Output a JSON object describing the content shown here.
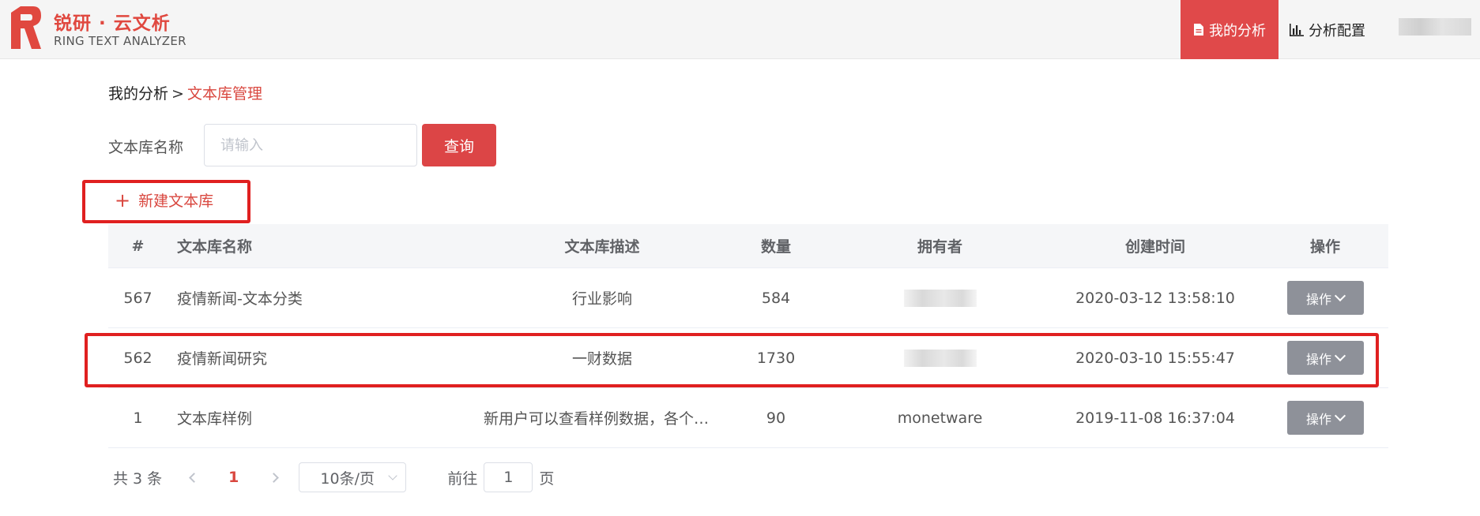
{
  "header": {
    "brand_cn": "锐研 · 云文析",
    "brand_en": "RING TEXT ANALYZER",
    "nav_active": "我的分析",
    "nav_config": "分析配置",
    "brand_color": "#e0483f"
  },
  "breadcrumb": {
    "root": "我的分析",
    "separator": ">",
    "current": "文本库管理"
  },
  "search": {
    "label": "文本库名称",
    "placeholder": "请输入",
    "button": "查询"
  },
  "new_library": {
    "label": "新建文本库"
  },
  "table": {
    "headers": {
      "id": "#",
      "name": "文本库名称",
      "desc": "文本库描述",
      "count": "数量",
      "owner": "拥有者",
      "time": "创建时间",
      "op": "操作"
    },
    "rows": [
      {
        "id": "567",
        "name": "疫情新闻-文本分类",
        "desc": "行业影响",
        "count": "584",
        "owner": "",
        "time": "2020-03-12 13:58:10",
        "op": "操作"
      },
      {
        "id": "562",
        "name": "疫情新闻研究",
        "desc": "一财数据",
        "count": "1730",
        "owner": "",
        "time": "2020-03-10 15:55:47",
        "op": "操作"
      },
      {
        "id": "1",
        "name": "文本库样例",
        "desc": "新用户可以查看样例数据，各个功…",
        "count": "90",
        "owner": "monetware",
        "time": "2019-11-08 16:37:04",
        "op": "操作"
      }
    ]
  },
  "pagination": {
    "total": "共 3 条",
    "current_page": "1",
    "page_size": "10条/页",
    "goto_label": "前往",
    "goto_value": "1",
    "page_suffix": "页"
  }
}
